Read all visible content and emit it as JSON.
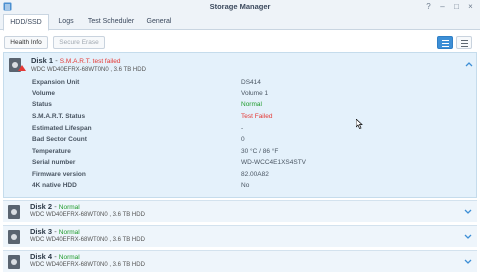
{
  "window": {
    "title": "Storage Manager",
    "help": "?",
    "minimize": "–",
    "maximize": "□",
    "close": "×"
  },
  "tabs": [
    "HDD/SSD",
    "Logs",
    "Test Scheduler",
    "General"
  ],
  "toolbar": {
    "health_info": "Health Info",
    "secure_erase": "Secure Erase"
  },
  "disk1": {
    "name": "Disk 1",
    "separator": " - ",
    "status": "S.M.A.R.T. test failed",
    "model": "WDC WD40EFRX-68WT0N0 , 3.6 TB HDD",
    "properties": [
      {
        "label": "Expansion Unit",
        "value": "DS414"
      },
      {
        "label": "Volume",
        "value": "Volume 1"
      },
      {
        "label": "Status",
        "value": "Normal"
      },
      {
        "label": "S.M.A.R.T. Status",
        "value": "Test Failed"
      },
      {
        "label": "Estimated Lifespan",
        "value": "-"
      },
      {
        "label": "Bad Sector Count",
        "value": "0"
      },
      {
        "label": "Temperature",
        "value": "30 °C / 86 °F"
      },
      {
        "label": "Serial number",
        "value": "WD-WCC4E1XS4STV"
      },
      {
        "label": "Firmware version",
        "value": "82.00A82"
      },
      {
        "label": "4K native HDD",
        "value": "No"
      }
    ]
  },
  "disks": [
    {
      "name": "Disk 2",
      "separator": " - ",
      "status": "Normal",
      "model": "WDC WD40EFRX-68WT0N0 , 3.6 TB HDD"
    },
    {
      "name": "Disk 3",
      "separator": " - ",
      "status": "Normal",
      "model": "WDC WD40EFRX-68WT0N0 , 3.6 TB HDD"
    },
    {
      "name": "Disk 4",
      "separator": " - ",
      "status": "Normal",
      "model": "WDC WD40EFRX-68WT0N0 , 3.6 TB HDD"
    }
  ],
  "colors": {
    "accent": "#3d8fd6",
    "normal": "#1f9c2c",
    "failed": "#e53935",
    "panel": "#e4f1fb"
  },
  "icons": {
    "app": "storage-manager-icon",
    "disk": "hdd-icon",
    "warning": "warning-icon",
    "expand": "chevron-down-icon",
    "collapse": "chevron-up-icon"
  }
}
